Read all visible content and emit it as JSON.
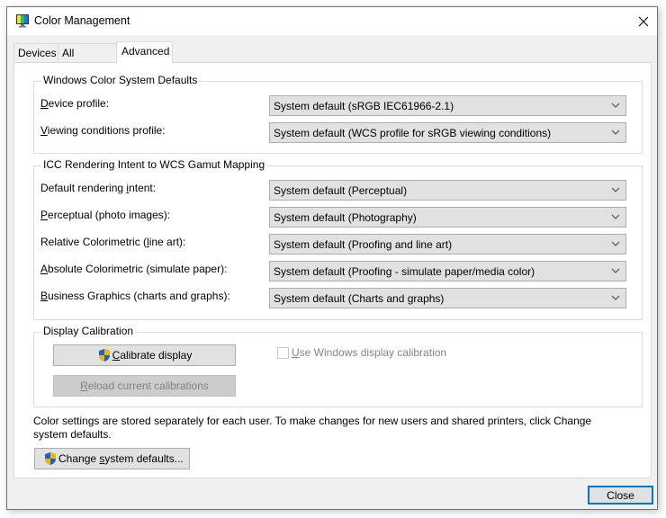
{
  "window": {
    "title": "Color Management",
    "close_icon": "close-icon",
    "app_icon": "monitor-color-icon"
  },
  "tabs": [
    {
      "label": "Devices",
      "active": false
    },
    {
      "label": "All Profiles",
      "active": false
    },
    {
      "label": "Advanced",
      "active": true
    }
  ],
  "wcs_defaults": {
    "title": "Windows Color System Defaults",
    "rows": [
      {
        "label_mnemonic": "D",
        "label_rest": "evice profile:",
        "value": "System default (sRGB IEC61966-2.1)"
      },
      {
        "label_mnemonic": "V",
        "label_rest": "iewing conditions profile:",
        "value": "System default (WCS profile for sRGB viewing conditions)"
      }
    ]
  },
  "icc_mapping": {
    "title": "ICC Rendering Intent to WCS Gamut Mapping",
    "rows": [
      {
        "label_pre": "Default rendering ",
        "label_mnemonic": "i",
        "label_post": "ntent:",
        "value": "System default (Perceptual)"
      },
      {
        "label_pre": "",
        "label_mnemonic": "P",
        "label_post": "erceptual (photo images):",
        "value": "System default (Photography)"
      },
      {
        "label_pre": "Relative Colorimetric (",
        "label_mnemonic": "l",
        "label_post": "ine art):",
        "value": "System default (Proofing and line art)"
      },
      {
        "label_pre": "",
        "label_mnemonic": "A",
        "label_post": "bsolute Colorimetric (simulate paper):",
        "value": "System default (Proofing - simulate paper/media color)"
      },
      {
        "label_pre": "",
        "label_mnemonic": "B",
        "label_post": "usiness Graphics (charts and graphs):",
        "value": "System default (Charts and graphs)"
      }
    ]
  },
  "calibration": {
    "title": "Display Calibration",
    "calibrate_mnemonic": "C",
    "calibrate_rest": "alibrate display",
    "reload_mnemonic": "R",
    "reload_rest": "eload current calibrations",
    "reload_enabled": false,
    "use_windows_mnemonic": "U",
    "use_windows_rest": "se Windows display calibration",
    "use_windows_checked": false,
    "use_windows_enabled": false
  },
  "note": "Color settings are stored separately for each user. To make changes for new users and shared printers, click Change system defaults.",
  "change_defaults": {
    "pre": "Change ",
    "mnemonic": "s",
    "post": "ystem defaults..."
  },
  "close_label": "Close",
  "colors": {
    "focus_border": "#0078d7",
    "button_face": "#e1e1e1",
    "disabled_text": "#838383"
  }
}
